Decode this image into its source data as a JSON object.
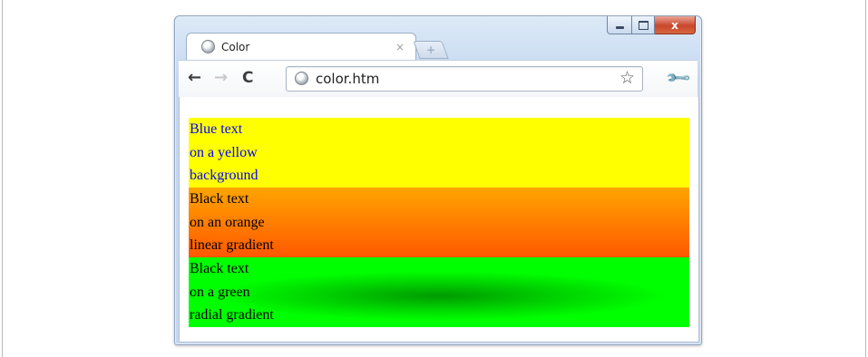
{
  "tab": {
    "title": "Color",
    "close_glyph": "×",
    "icon": "globe-icon"
  },
  "new_tab": {
    "icon": "new-tab-icon"
  },
  "window_controls": {
    "close_glyph": "x"
  },
  "toolbar": {
    "back_glyph": "←",
    "forward_glyph": "→",
    "reload_glyph": "C",
    "url": "color.htm",
    "bookmark_glyph": "☆",
    "wrench_glyph": "🔧"
  },
  "content": {
    "blocks": [
      {
        "lines": [
          "Blue text",
          "on a yellow",
          "background"
        ],
        "text_color": "#0000ff",
        "background": "#ffff00"
      },
      {
        "lines": [
          "Black text",
          "on an orange",
          "linear gradient"
        ],
        "text_color": "#000000",
        "background": "linear-gradient #ffa500 → #ff5800"
      },
      {
        "lines": [
          "Black text",
          "on a green",
          "radial gradient"
        ],
        "text_color": "#000000",
        "background": "radial-gradient #009a00 → #00ff00"
      }
    ]
  }
}
